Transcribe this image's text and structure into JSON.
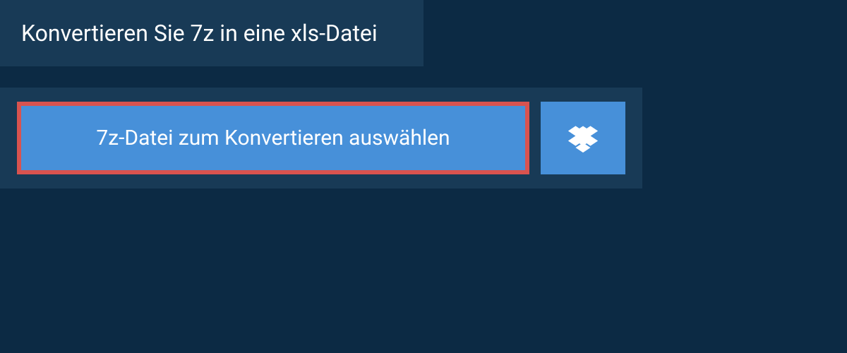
{
  "header": {
    "title": "Konvertieren Sie 7z in eine xls-Datei"
  },
  "actions": {
    "select_file_label": "7z-Datei zum Konvertieren auswählen",
    "dropbox_icon_name": "dropbox"
  },
  "colors": {
    "background": "#0c2a44",
    "panel": "#183a56",
    "button": "#4790d9",
    "highlight_border": "#d9534f",
    "text": "#ffffff"
  }
}
